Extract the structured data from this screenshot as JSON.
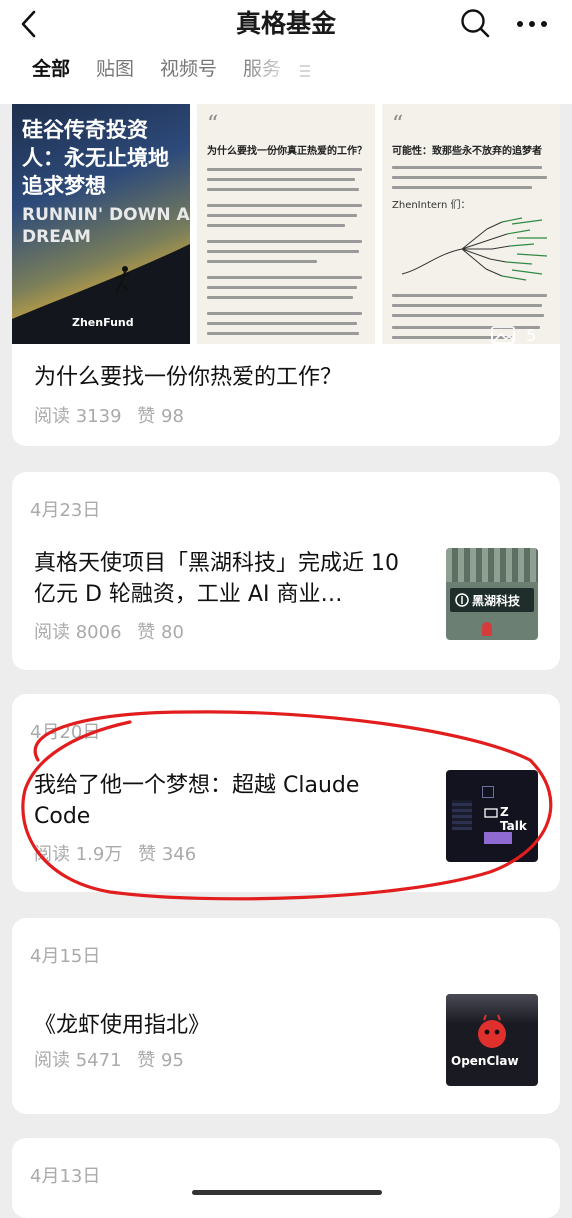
{
  "header": {
    "title": "真格基金",
    "tabs": [
      {
        "label": "全部"
      },
      {
        "label": "贴图"
      },
      {
        "label": "视频号"
      },
      {
        "label": "服务"
      }
    ]
  },
  "colors": {
    "background": "#ededed",
    "card": "#ffffff",
    "annotation": "#e21d1d",
    "muted_text": "#aaaaaa"
  },
  "feed": {
    "post1": {
      "images": {
        "cover_cn": "硅谷传奇投资人：永无止境地追求梦想",
        "cover_en": "RUNNIN' DOWN A DREAM",
        "cover_brand": "ZhenFund",
        "doc1_title": "为什么要找一份你真正热爱的工作？",
        "doc2_title": "可能性：致那些永不放弃的追梦者",
        "doc2_sub": "ZhenIntern 们：",
        "image_count": "5"
      },
      "title": "为什么要找一份你热爱的工作？",
      "reads": "阅读 3139",
      "likes": "赞 98"
    },
    "post2": {
      "date": "4月23日",
      "title": "真格天使项目「黑湖科技」完成近 10 亿元 D 轮融资，工业 AI 商业…",
      "reads": "阅读 8006",
      "likes": "赞 80",
      "thumb_text": "黑湖科技"
    },
    "post3": {
      "date": "4月20日",
      "title": "我给了他一个梦想：超越 Claude Code",
      "reads": "阅读 1.9万",
      "likes": "赞 346",
      "thumb_text": "Z Talk"
    },
    "post4": {
      "date": "4月15日",
      "title": "《龙虾使用指北》",
      "reads": "阅读 5471",
      "likes": "赞 95",
      "thumb_text": "OpenClaw"
    },
    "post5": {
      "date": "4月13日"
    }
  }
}
